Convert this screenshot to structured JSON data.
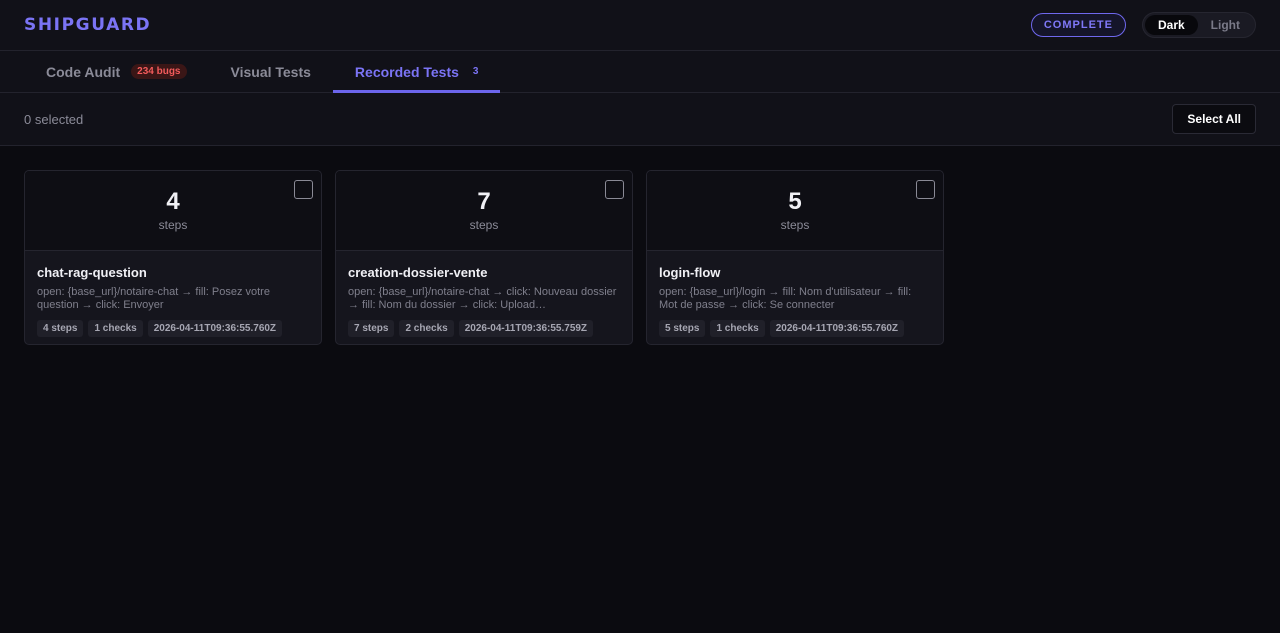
{
  "header": {
    "logo": "SHIPGUARD",
    "status": "COMPLETE",
    "theme": {
      "dark": "Dark",
      "light": "Light",
      "active": "dark"
    }
  },
  "tabs": [
    {
      "label": "Code Audit",
      "badge": "234 bugs"
    },
    {
      "label": "Visual Tests"
    },
    {
      "label": "Recorded Tests",
      "count": "3",
      "active": true
    }
  ],
  "selection": {
    "count_text": "0 selected",
    "select_all": "Select All"
  },
  "tests": [
    {
      "steps": "4",
      "steps_label": "steps",
      "name": "chat-rag-question",
      "description": "open: {base_url}/notaire-chat → fill: Posez votre question → click: Envoyer",
      "chip_steps": "4 steps",
      "chip_checks": "1 checks",
      "timestamp": "2026-04-11T09:36:55.760Z"
    },
    {
      "steps": "7",
      "steps_label": "steps",
      "name": "creation-dossier-vente",
      "description": "open: {base_url}/notaire-chat → click: Nouveau dossier → fill: Nom du dossier → click: Upload…",
      "chip_steps": "7 steps",
      "chip_checks": "2 checks",
      "timestamp": "2026-04-11T09:36:55.759Z"
    },
    {
      "steps": "5",
      "steps_label": "steps",
      "name": "login-flow",
      "description": "open: {base_url}/login → fill: Nom d'utilisateur → fill: Mot de passe → click: Se connecter",
      "chip_steps": "5 steps",
      "chip_checks": "1 checks",
      "timestamp": "2026-04-11T09:36:55.760Z"
    }
  ],
  "colors": {
    "accent": "#7b74f5",
    "danger": "#f35b5b",
    "background": "#0b0b10",
    "surface": "#111118"
  }
}
